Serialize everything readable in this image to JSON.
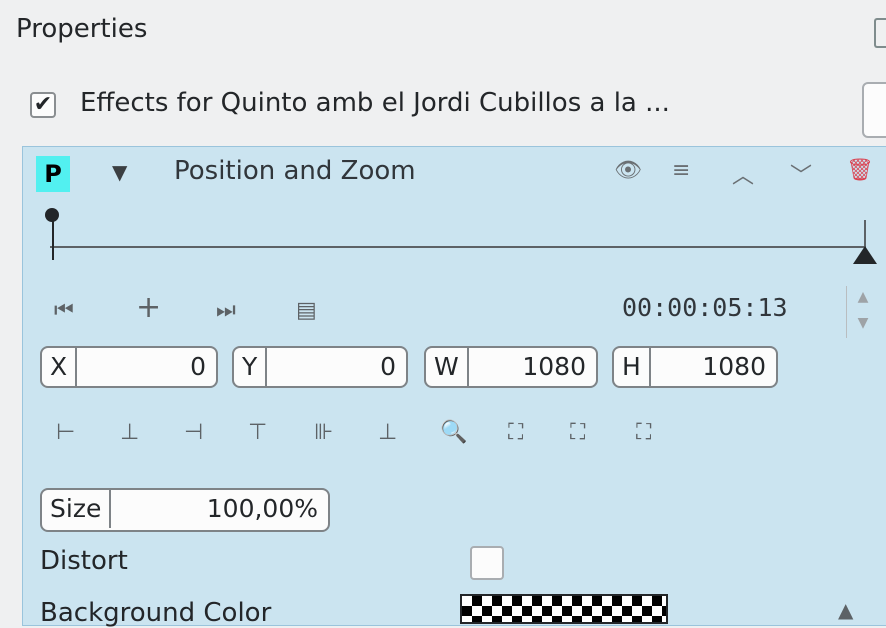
{
  "header": {
    "title": "Properties"
  },
  "effects_stack": {
    "checked": "✔",
    "label": "Effects for Quinto amb el Jordi Cubillos a la ..."
  },
  "effect": {
    "badge": "P",
    "collapse_icon": "▼",
    "name": "Position and Zoom",
    "header_icons": {
      "visibility": "👁",
      "menu": "≡",
      "move_up": "︿",
      "move_down": "﹀",
      "delete": "🗑"
    }
  },
  "keyframe_toolbar": {
    "prev_icon": "⏮",
    "add_icon": "+",
    "next_icon": "⏭",
    "options_icon": "▤",
    "timecode": "00:00:05:13",
    "spin_up": "▲",
    "spin_down": "▼"
  },
  "params": [
    {
      "label": "X",
      "value": "0"
    },
    {
      "label": "Y",
      "value": "0"
    },
    {
      "label": "W",
      "value": "1080"
    },
    {
      "label": "H",
      "value": "1080"
    }
  ],
  "align_icons": [
    "⊢",
    "⊥",
    "⊣",
    "⊤",
    "⊪",
    "⊥",
    "🔍",
    "⛶",
    "⛶",
    "⛶"
  ],
  "size": {
    "label": "Size",
    "value": "100,00%"
  },
  "distort": {
    "label": "Distort"
  },
  "background": {
    "label": "Background Color",
    "arrow": "▲"
  }
}
